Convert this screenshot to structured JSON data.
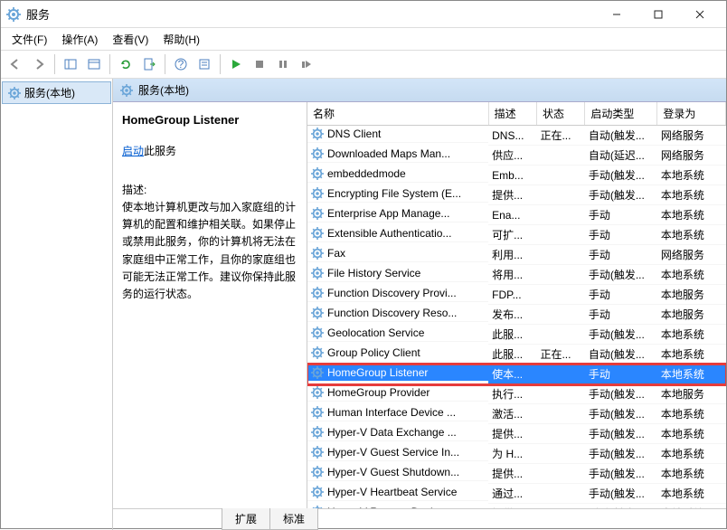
{
  "window": {
    "title": "服务"
  },
  "menu": {
    "file": "文件(F)",
    "action": "操作(A)",
    "view": "查看(V)",
    "help": "帮助(H)"
  },
  "tree": {
    "root": "服务(本地)"
  },
  "panel_header": "服务(本地)",
  "detail": {
    "name": "HomeGroup Listener",
    "start_link": "启动",
    "start_suffix": "此服务",
    "desc_label": "描述:",
    "description": "使本地计算机更改与加入家庭组的计算机的配置和维护相关联。如果停止或禁用此服务，你的计算机将无法在家庭组中正常工作，且你的家庭组也可能无法正常工作。建议你保持此服务的运行状态。"
  },
  "columns": {
    "name": "名称",
    "desc": "描述",
    "status": "状态",
    "startup": "启动类型",
    "logon": "登录为"
  },
  "services": [
    {
      "name": "DNS Client",
      "desc": "DNS...",
      "status": "正在...",
      "startup": "自动(触发...",
      "logon": "网络服务"
    },
    {
      "name": "Downloaded Maps Man...",
      "desc": "供应...",
      "status": "",
      "startup": "自动(延迟...",
      "logon": "网络服务"
    },
    {
      "name": "embeddedmode",
      "desc": "Emb...",
      "status": "",
      "startup": "手动(触发...",
      "logon": "本地系统"
    },
    {
      "name": "Encrypting File System (E...",
      "desc": "提供...",
      "status": "",
      "startup": "手动(触发...",
      "logon": "本地系统"
    },
    {
      "name": "Enterprise App Manage...",
      "desc": "Ena...",
      "status": "",
      "startup": "手动",
      "logon": "本地系统"
    },
    {
      "name": "Extensible Authenticatio...",
      "desc": "可扩...",
      "status": "",
      "startup": "手动",
      "logon": "本地系统"
    },
    {
      "name": "Fax",
      "desc": "利用...",
      "status": "",
      "startup": "手动",
      "logon": "网络服务"
    },
    {
      "name": "File History Service",
      "desc": "将用...",
      "status": "",
      "startup": "手动(触发...",
      "logon": "本地系统"
    },
    {
      "name": "Function Discovery Provi...",
      "desc": "FDP...",
      "status": "",
      "startup": "手动",
      "logon": "本地服务"
    },
    {
      "name": "Function Discovery Reso...",
      "desc": "发布...",
      "status": "",
      "startup": "手动",
      "logon": "本地服务"
    },
    {
      "name": "Geolocation Service",
      "desc": "此服...",
      "status": "",
      "startup": "手动(触发...",
      "logon": "本地系统"
    },
    {
      "name": "Group Policy Client",
      "desc": "此服...",
      "status": "正在...",
      "startup": "自动(触发...",
      "logon": "本地系统"
    },
    {
      "name": "HomeGroup Listener",
      "desc": "使本...",
      "status": "",
      "startup": "手动",
      "logon": "本地系统",
      "selected": true
    },
    {
      "name": "HomeGroup Provider",
      "desc": "执行...",
      "status": "",
      "startup": "手动(触发...",
      "logon": "本地服务"
    },
    {
      "name": "Human Interface Device ...",
      "desc": "激活...",
      "status": "",
      "startup": "手动(触发...",
      "logon": "本地系统"
    },
    {
      "name": "Hyper-V Data Exchange ...",
      "desc": "提供...",
      "status": "",
      "startup": "手动(触发...",
      "logon": "本地系统"
    },
    {
      "name": "Hyper-V Guest Service In...",
      "desc": "为 H...",
      "status": "",
      "startup": "手动(触发...",
      "logon": "本地系统"
    },
    {
      "name": "Hyper-V Guest Shutdown...",
      "desc": "提供...",
      "status": "",
      "startup": "手动(触发...",
      "logon": "本地系统"
    },
    {
      "name": "Hyper-V Heartbeat Service",
      "desc": "通过...",
      "status": "",
      "startup": "手动(触发...",
      "logon": "本地系统"
    },
    {
      "name": "Hyper-V Remote Deskto...",
      "desc": "提供...",
      "status": "",
      "startup": "手动(触发...",
      "logon": "本地系统"
    }
  ],
  "tabs": {
    "extended": "扩展",
    "standard": "标准"
  }
}
